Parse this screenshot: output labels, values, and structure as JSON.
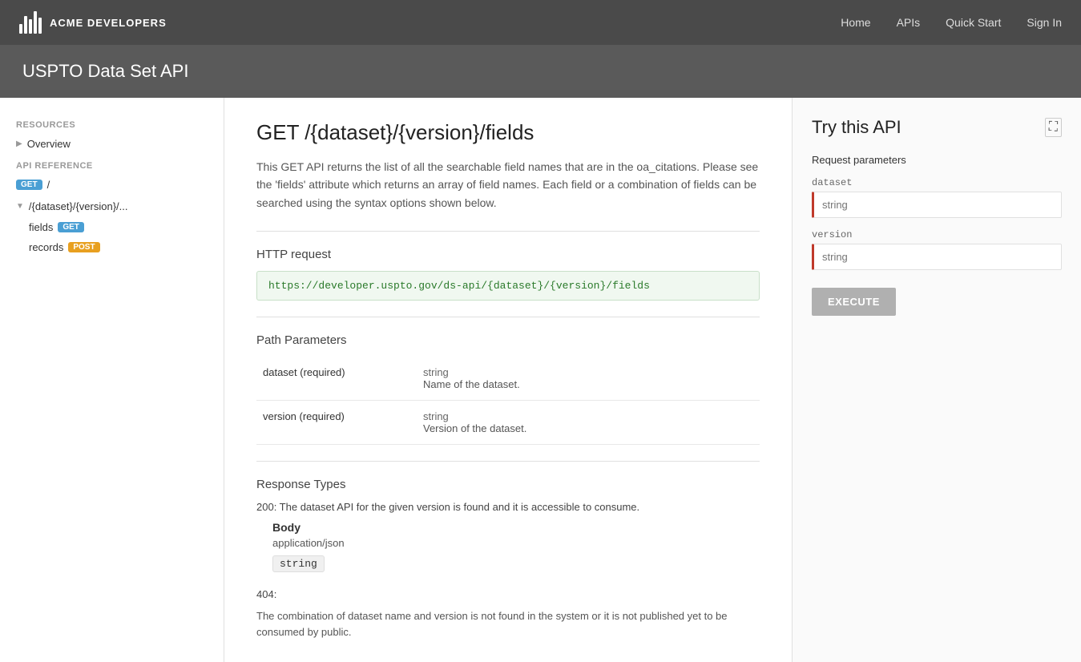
{
  "topNav": {
    "logoText": "ACME DEVELOPERS",
    "links": [
      "Home",
      "APIs",
      "Quick Start",
      "Sign In"
    ]
  },
  "subHeader": {
    "title": "USPTO Data Set API"
  },
  "sidebar": {
    "resourcesLabel": "RESOURCES",
    "overviewLabel": "Overview",
    "apiReferenceLabel": "API REFERENCE",
    "slashGetBadge": "GET",
    "datasetPath": "/{dataset}/{version}/...",
    "fieldsLabel": "fields",
    "fieldsGetBadge": "GET",
    "recordsLabel": "records",
    "recordsPostBadge": "POST"
  },
  "main": {
    "endpointTitle": "GET /{dataset}/{version}/fields",
    "description": "This GET API returns the list of all the searchable field names that are in the oa_citations. Please see the 'fields' attribute which returns an array of field names. Each field or a combination of fields can be searched using the syntax options shown below.",
    "httpRequestLabel": "HTTP request",
    "endpointUrl": "https://developer.uspto.gov/ds-api/{dataset}/{version}/fields",
    "pathParamsLabel": "Path Parameters",
    "params": [
      {
        "name": "dataset (required)",
        "type": "string",
        "desc": "Name of the dataset."
      },
      {
        "name": "version (required)",
        "type": "string",
        "desc": "Version of the dataset."
      }
    ],
    "responseTypesLabel": "Response Types",
    "response200": "200: The dataset API for the given version is found and it is accessible to consume.",
    "bodyLabel": "Body",
    "contentType": "application/json",
    "bodyType": "string",
    "response404Text": "404:",
    "response404Desc": "The combination of dataset name and version is not found in the system or it is not published yet to be consumed by public."
  },
  "tryPanel": {
    "title": "Try this API",
    "requestParamsLabel": "Request parameters",
    "datasetLabel": "dataset",
    "datasetPlaceholder": "string",
    "versionLabel": "version",
    "versionPlaceholder": "string",
    "executeLabel": "EXECUTE"
  }
}
